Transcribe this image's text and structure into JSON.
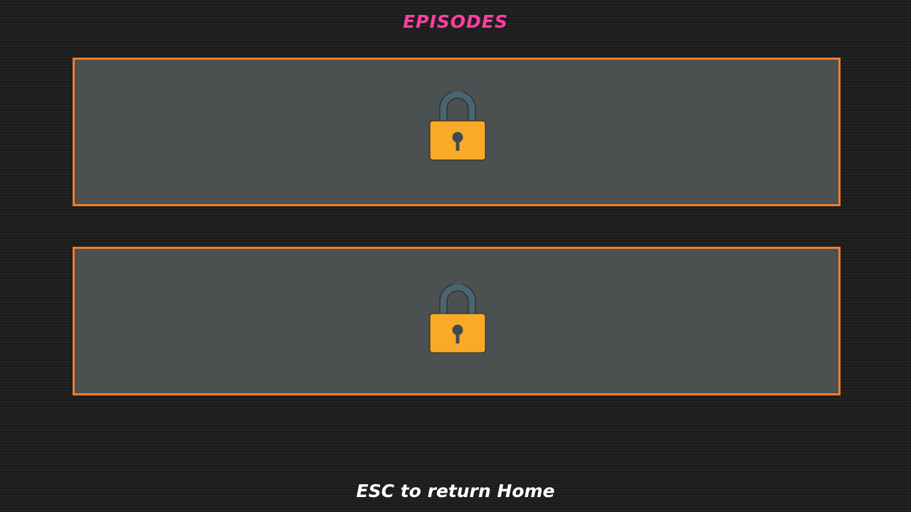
{
  "screen": {
    "title": "EPISODES",
    "footer_hint": "ESC to return Home"
  },
  "episodes": [
    {
      "state": "locked",
      "icon": "padlock-icon"
    },
    {
      "state": "locked",
      "icon": "padlock-icon"
    }
  ],
  "colors": {
    "title": "#ff3fa0",
    "card_border": "#f07d2e",
    "card_fill": "#4b5050",
    "lock_body": "#f9aa26",
    "lock_shackle": "#4a6470",
    "footer_text": "#ffffff"
  }
}
